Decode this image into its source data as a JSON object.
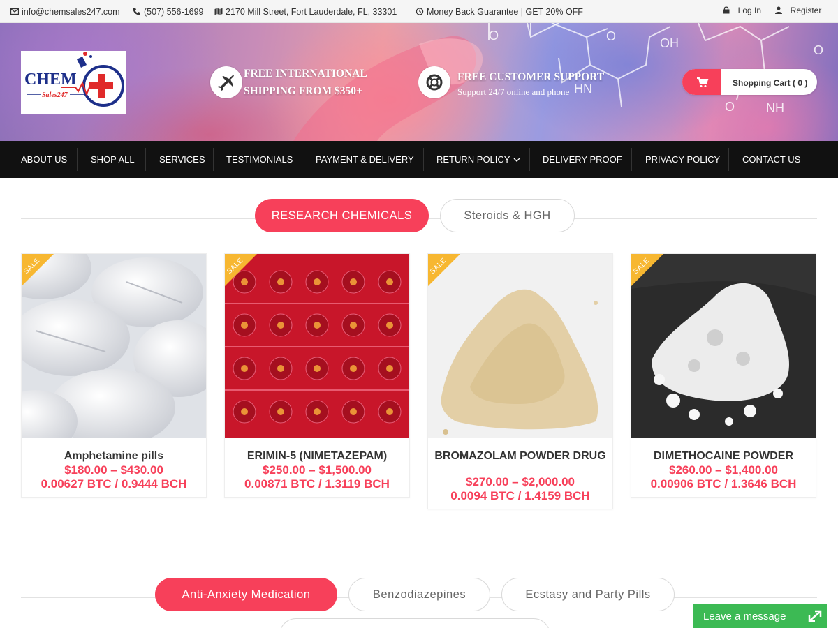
{
  "topbar": {
    "email": "info@chemsales247.com",
    "phone": "(507) 556-1699",
    "address": "2170 Mill Street, Fort Lauderdale, FL, 33301",
    "guarantee": "Money Back Guarantee | GET 20% OFF",
    "login": "Log In",
    "register": "Register",
    "icons": [
      "envelope-icon",
      "phone-icon",
      "map-icon",
      "clock-icon",
      "lock-icon",
      "user-icon"
    ]
  },
  "header": {
    "logo": {
      "word1": "CHEM",
      "word2": "Sales247"
    },
    "shipping": {
      "line1": "FREE INTERNATIONAL",
      "line2": "SHIPPING FROM $350+",
      "icon": "plane-icon"
    },
    "support": {
      "title": "FREE CUSTOMER SUPPORT",
      "subtitle": "Support 24/7 online and phone",
      "icon": "lifebuoy-icon"
    },
    "cart": {
      "label": "Shopping Cart ( 0 )",
      "icon": "cart-icon"
    },
    "background_molecule_labels": [
      "O",
      "OH",
      "O",
      "HN",
      "O",
      "NH",
      "O"
    ]
  },
  "nav": [
    "ABOUT US",
    "SHOP ALL",
    "SERVICES",
    "TESTIMONIALS",
    "PAYMENT & DELIVERY",
    "RETURN POLICY",
    "DELIVERY PROOF",
    "PRIVACY POLICY",
    "CONTACT US"
  ],
  "tabs_primary": [
    {
      "label": "RESEARCH CHEMICALS",
      "active": true
    },
    {
      "label": "Steroids & HGH",
      "active": false
    }
  ],
  "products": [
    {
      "name": "Amphetamine pills",
      "price": "$180.00 – $430.00",
      "crypto": "0.00627 BTC  /  0.9444 BCH",
      "badge": "SALE"
    },
    {
      "name": "ERIMIN-5 (NIMETAZEPAM)",
      "price": "$250.00 – $1,500.00",
      "crypto": "0.00871 BTC  /  1.3119 BCH",
      "badge": "SALE"
    },
    {
      "name": "BROMAZOLAM POWDER DRUG",
      "price": "$270.00 – $2,000.00",
      "crypto": "0.0094 BTC  /  1.4159 BCH",
      "badge": "SALE"
    },
    {
      "name": "DIMETHOCAINE POWDER",
      "price": "$260.00 – $1,400.00",
      "crypto": "0.00906 BTC  /  1.3646 BCH",
      "badge": "SALE"
    }
  ],
  "tabs_secondary": [
    {
      "label": "Anti-Anxiety Medication",
      "active": true
    },
    {
      "label": "Benzodiazepines",
      "active": false
    },
    {
      "label": "Ecstasy and Party Pills",
      "active": false
    }
  ],
  "chat": {
    "label": "Leave a message",
    "icon": "maximize-icon"
  },
  "colors": {
    "accent": "#f7405a",
    "nav_bg": "#111111",
    "chat_bg": "#3cba54",
    "sale_badge": "#f7b731"
  }
}
